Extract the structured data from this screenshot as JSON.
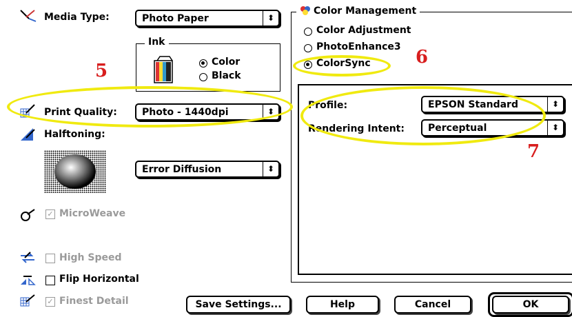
{
  "media_type": {
    "label": "Media Type:",
    "value": "Photo Paper",
    "icon": "media-type-icon"
  },
  "ink": {
    "title": "Ink",
    "options": [
      {
        "label": "Color",
        "selected": true
      },
      {
        "label": "Black",
        "selected": false
      }
    ]
  },
  "print_quality": {
    "label": "Print Quality:",
    "value": "Photo - 1440dpi",
    "icon": "print-quality-icon"
  },
  "halftoning": {
    "label": "Halftoning:",
    "value": "Error Diffusion",
    "icon": "halftoning-icon"
  },
  "options": {
    "microweave": {
      "label": "MicroWeave",
      "checked": true,
      "enabled": false
    },
    "high_speed": {
      "label": "High Speed",
      "checked": false,
      "enabled": false
    },
    "flip_horizontal": {
      "label": "Flip Horizontal",
      "checked": false,
      "enabled": true
    },
    "finest_detail": {
      "label": "Finest Detail",
      "checked": true,
      "enabled": false
    }
  },
  "color_management": {
    "title": "Color Management",
    "modes": [
      {
        "label": "Color Adjustment",
        "selected": false
      },
      {
        "label": "PhotoEnhance3",
        "selected": false
      },
      {
        "label": "ColorSync",
        "selected": true
      }
    ],
    "profile": {
      "label": "Profile:",
      "value": "EPSON Standard"
    },
    "rendering_intent": {
      "label": "Rendering Intent:",
      "value": "Perceptual"
    }
  },
  "buttons": {
    "save_settings": "Save Settings...",
    "help": "Help",
    "cancel": "Cancel",
    "ok": "OK"
  },
  "callouts": {
    "five": "5",
    "six": "6",
    "seven": "7"
  },
  "colors": {
    "highlight": "#f0ea10",
    "callout_red": "#d81e1e"
  }
}
